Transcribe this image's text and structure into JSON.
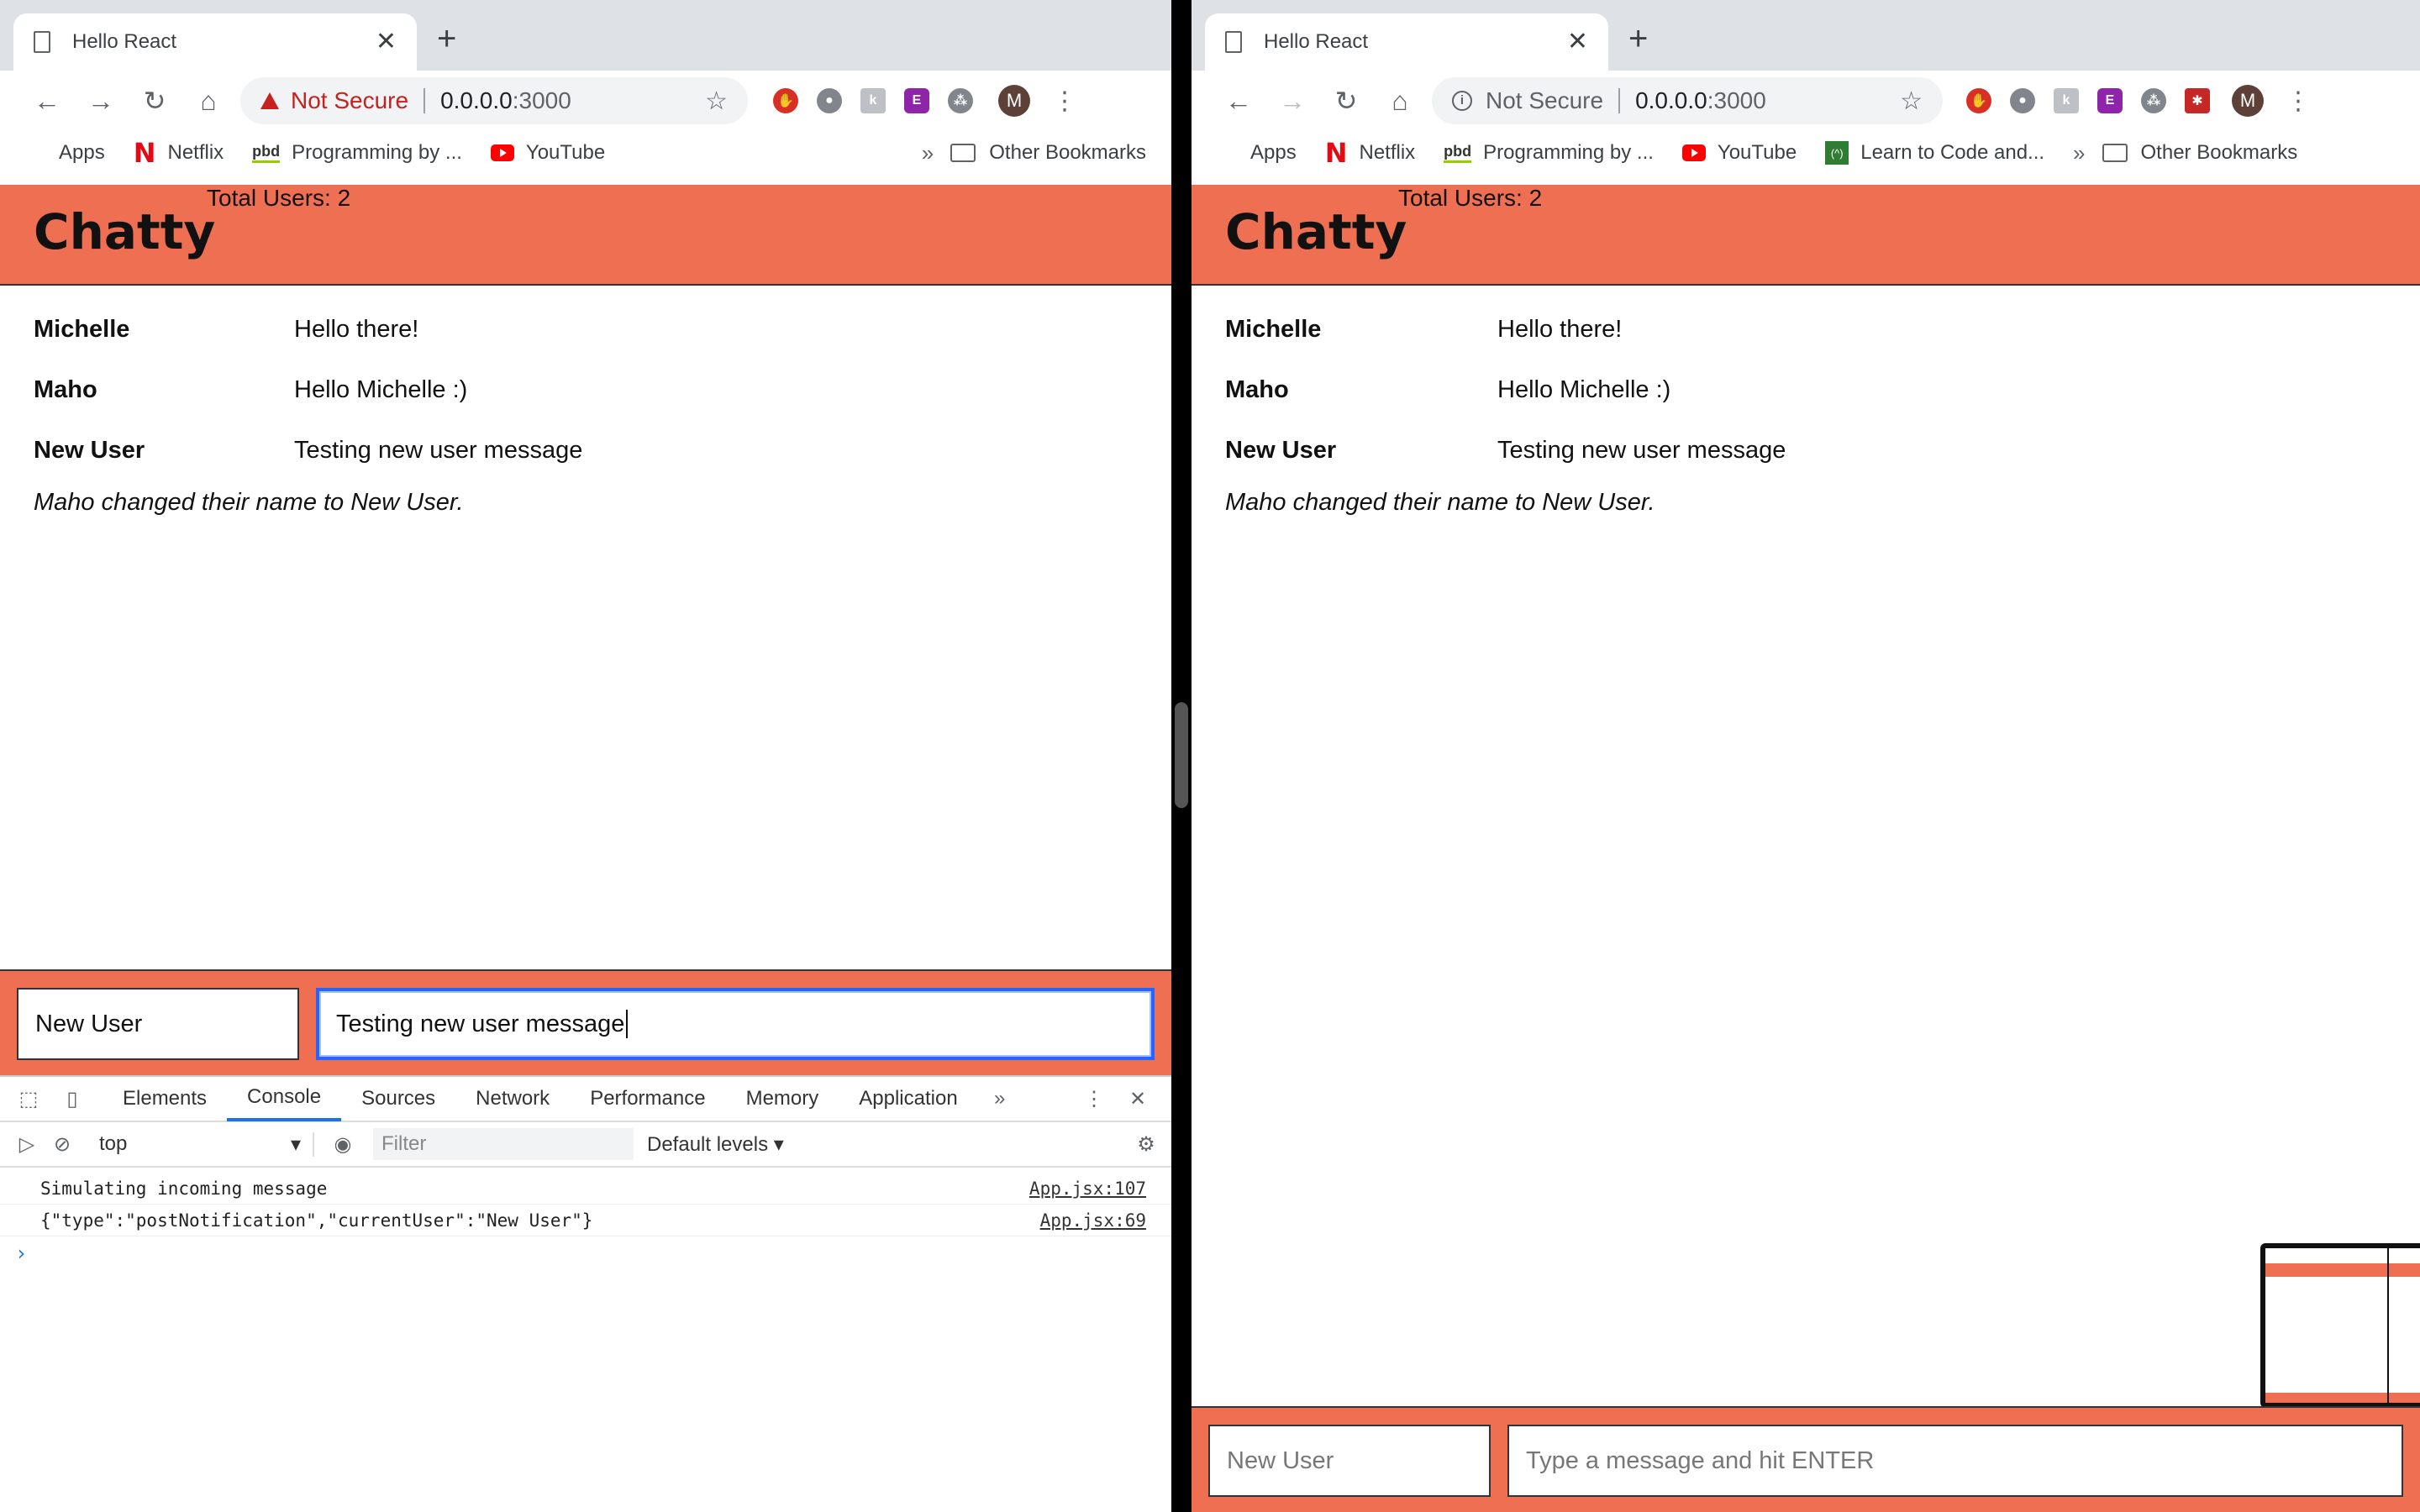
{
  "left": {
    "tab_title": "Hello React",
    "not_secure": "Not Secure",
    "url_host": "0.0.0.0",
    "url_port": ":3000",
    "avatar_letter": "M",
    "bookmarks": [
      "Apps",
      "Netflix",
      "Programming by ...",
      "YouTube"
    ],
    "other_bookmarks": "Other Bookmarks",
    "app": {
      "brand": "Chatty",
      "user_count": "Total Users: 2",
      "messages": [
        {
          "username": "Michelle",
          "content": "Hello there!"
        },
        {
          "username": "Maho",
          "content": "Hello Michelle :)"
        },
        {
          "username": "New User",
          "content": "Testing new user message"
        }
      ],
      "notification": "Maho changed their name to New User.",
      "username_field": "New User",
      "message_field": "Testing new user message"
    },
    "devtools": {
      "tabs": [
        "Elements",
        "Console",
        "Sources",
        "Network",
        "Performance",
        "Memory",
        "Application"
      ],
      "active_tab": "Console",
      "context": "top",
      "filter_placeholder": "Filter",
      "levels": "Default levels ▾",
      "logs": [
        {
          "text": "Simulating incoming message",
          "source": "App.jsx:107"
        },
        {
          "text": "{\"type\":\"postNotification\",\"currentUser\":\"New User\"}",
          "source": "App.jsx:69"
        }
      ],
      "prompt": "›"
    }
  },
  "right": {
    "tab_title": "Hello React",
    "not_secure": "Not Secure",
    "url_host": "0.0.0.0",
    "url_port": ":3000",
    "avatar_letter": "M",
    "bookmarks": [
      "Apps",
      "Netflix",
      "Programming by ...",
      "YouTube",
      "Learn to Code and..."
    ],
    "other_bookmarks": "Other Bookmarks",
    "app": {
      "brand": "Chatty",
      "user_count": "Total Users: 2",
      "messages": [
        {
          "username": "Michelle",
          "content": "Hello there!"
        },
        {
          "username": "Maho",
          "content": "Hello Michelle :)"
        },
        {
          "username": "New User",
          "content": "Testing new user message"
        }
      ],
      "notification": "Maho changed their name to New User.",
      "username_placeholder": "New User",
      "message_placeholder": "Type a message and hit ENTER"
    }
  },
  "colors": {
    "accent": "#ef6f52",
    "focus": "#2962ff",
    "devtools_active": "#1a73e8"
  }
}
